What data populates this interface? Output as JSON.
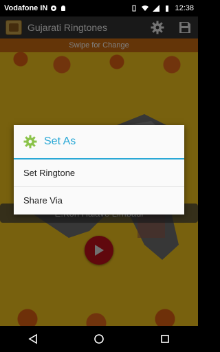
{
  "status_bar": {
    "carrier": "Vodafone IN",
    "time": "12:38"
  },
  "app_bar": {
    "title": "Gujarati Ringtones",
    "settings_icon": "gear-icon",
    "save_icon": "save-icon"
  },
  "content": {
    "swipe_hint": "Swipe for Change",
    "caption": "E.Kon Halave Limbadi"
  },
  "dialog": {
    "title": "Set As",
    "items": [
      "Set Ringtone",
      "Share Via"
    ]
  },
  "colors": {
    "accent": "#2aa8d6",
    "play": "#c0101a",
    "background": "#f1c21d"
  }
}
